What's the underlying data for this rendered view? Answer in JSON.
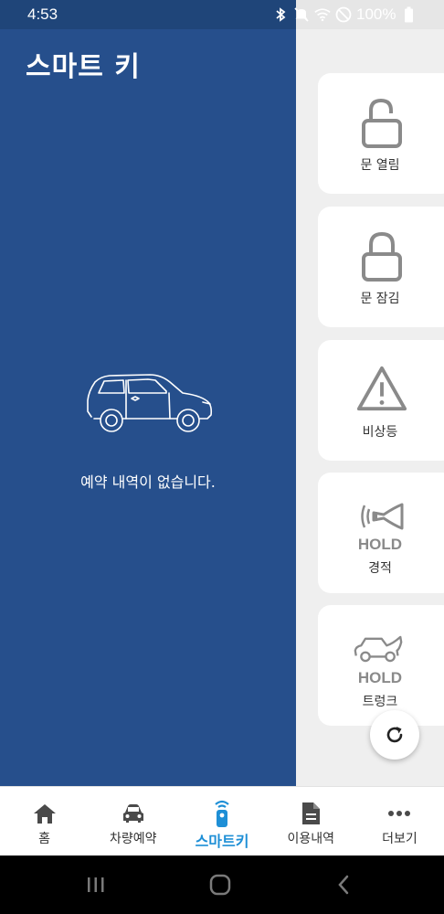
{
  "status_bar": {
    "time": "4:53",
    "battery_text": "100%",
    "icons": [
      "bluetooth-icon",
      "mute-icon",
      "wifi-icon",
      "dnd-icon",
      "battery-icon"
    ]
  },
  "page": {
    "title": "스마트 키",
    "empty_message": "예약 내역이 없습니다."
  },
  "controls": [
    {
      "label": "문 열림",
      "icon": "unlock-icon"
    },
    {
      "label": "문 잠김",
      "icon": "lock-icon"
    },
    {
      "label": "비상등",
      "icon": "warning-icon"
    },
    {
      "label": "경적",
      "hold": "HOLD",
      "icon": "horn-icon"
    },
    {
      "label": "트렁크",
      "hold": "HOLD",
      "icon": "trunk-icon"
    }
  ],
  "bottom_nav": [
    {
      "label": "홈",
      "icon": "home-icon"
    },
    {
      "label": "차량예약",
      "icon": "car-icon"
    },
    {
      "label": "스마트키",
      "icon": "smart-key-icon",
      "active": true
    },
    {
      "label": "이용내역",
      "icon": "document-icon"
    },
    {
      "label": "더보기",
      "icon": "more-icon"
    }
  ],
  "colors": {
    "panel_blue": "#264f8c",
    "accent": "#1e8fd6",
    "icon_gray": "#8a8a8a"
  }
}
